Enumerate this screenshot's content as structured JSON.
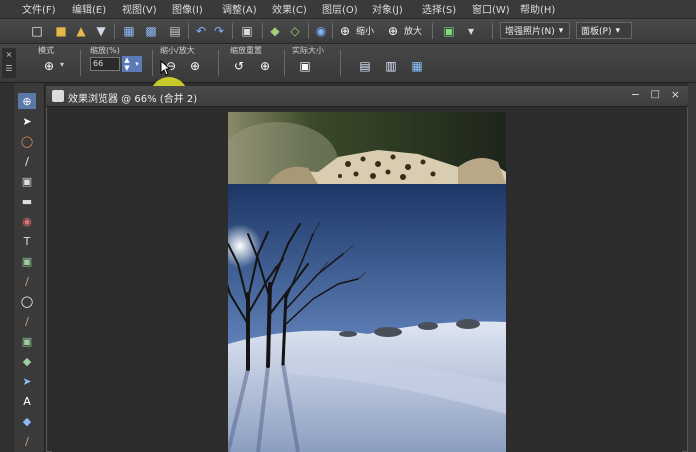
{
  "menu": [
    "文件(F)",
    "编辑(E)",
    "视图(V)",
    "图像(I)",
    "调整(A)",
    "效果(C)",
    "图层(O)",
    "对象(J)",
    "选择(S)",
    "窗口(W)",
    "帮助(H)"
  ],
  "toolbar": {
    "shrink_label": "缩小",
    "enlarge_label": "放大",
    "enhance_dropdown": "增强照片(N)",
    "panel_dropdown": "面板(P)"
  },
  "propbar": {
    "mode_label": "模式",
    "zoom_label": "缩放(%)",
    "zoom_value": "66",
    "shrink_enlarge_label": "缩小/放大",
    "zoom_reset_label": "缩放重置",
    "actual_size_label": "实际大小"
  },
  "document": {
    "title": "效果浏览器 @ 66% (合并 2)"
  },
  "colors": {
    "accent_highlight": "#e2e628",
    "ui_background": "#3a3a3a",
    "canvas_background": "#2c2c2c"
  }
}
